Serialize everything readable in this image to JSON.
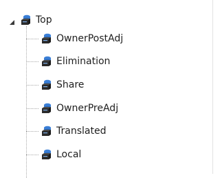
{
  "tree": {
    "root": {
      "label": "Top",
      "expanded": true,
      "icon": "dimension-member-icon"
    },
    "children": [
      {
        "label": "OwnerPostAdj",
        "icon": "dimension-member-icon"
      },
      {
        "label": "Elimination",
        "icon": "dimension-member-icon"
      },
      {
        "label": "Share",
        "icon": "dimension-member-icon"
      },
      {
        "label": "OwnerPreAdj",
        "icon": "dimension-member-icon"
      },
      {
        "label": "Translated",
        "icon": "dimension-member-icon"
      },
      {
        "label": "Local",
        "icon": "dimension-member-icon"
      }
    ]
  },
  "colors": {
    "icon_blue": "#3b7fd6",
    "icon_dark": "#2b2b2b",
    "connector": "#a9a9a9"
  }
}
